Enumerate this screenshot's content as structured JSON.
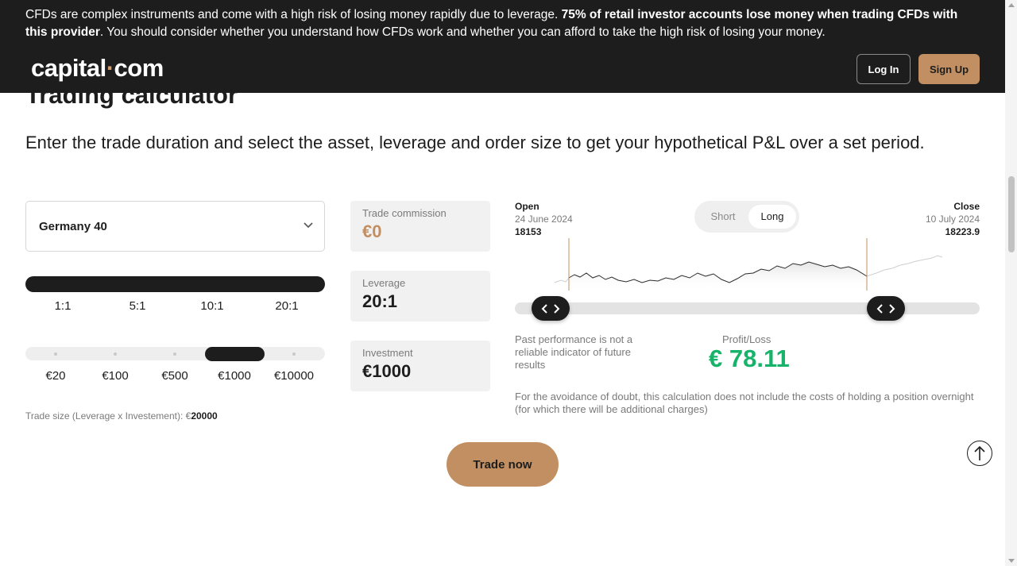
{
  "risk_warning": {
    "part1": "CFDs are complex instruments and come with a high risk of losing money rapidly due to leverage.",
    "bold": "75% of retail investor accounts lose money when trading CFDs with this provider",
    "part2": ". You should consider whether you understand how CFDs work and whether you can afford to take the high risk of losing your money."
  },
  "header": {
    "logo_left": "capital",
    "logo_dot": "·",
    "logo_right": "com",
    "login_label": "Log In",
    "signup_label": "Sign Up"
  },
  "page": {
    "title": "Trading calculator",
    "intro": "Enter the trade duration and select the asset, leverage and order size to get your hypothetical P&L over a set period."
  },
  "asset": {
    "selected": "Germany 40"
  },
  "leverage_options": [
    "1:1",
    "5:1",
    "10:1",
    "20:1"
  ],
  "investment_options": [
    "€20",
    "€100",
    "€500",
    "€1000",
    "€10000"
  ],
  "investment_selected": "€1000",
  "trade_size": {
    "label": "Trade size (Leverage x Investement): €",
    "value": "20000"
  },
  "info": {
    "commission_label": "Trade commission",
    "commission_value": "€0",
    "leverage_label": "Leverage",
    "leverage_value": "20:1",
    "investment_label": "Investment",
    "investment_value": "€1000"
  },
  "chart_panel": {
    "open_label": "Open",
    "open_date": "24 June 2024",
    "open_price": "18153",
    "close_label": "Close",
    "close_date": "10 July 2024",
    "close_price": "18223.9",
    "direction_short": "Short",
    "direction_long": "Long",
    "direction_selected": "Long"
  },
  "results": {
    "past_performance_note": "Past performance is not a reliable indicator of future results",
    "pl_label": "Profit/Loss",
    "pl_value": "€ 78.11",
    "doubt_note": "For the avoidance of doubt, this calculation does not include the costs of holding a position overnight (for which there will be additional charges)"
  },
  "cta": {
    "trade_now": "Trade now"
  },
  "colors": {
    "accent": "#c18f62",
    "dark": "#1d1d1d",
    "profit_green": "#18b36b"
  }
}
